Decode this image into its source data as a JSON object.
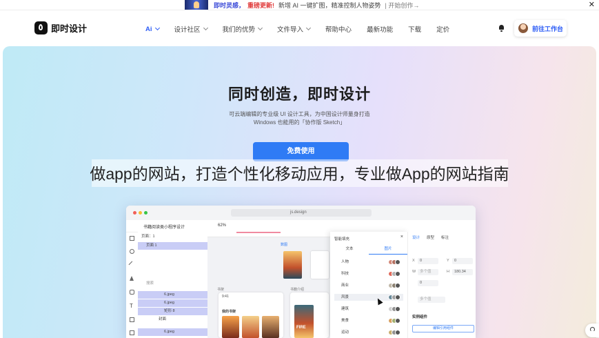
{
  "banner": {
    "highlight_1": "即时灵感，",
    "highlight_2": "重磅更新!",
    "text": "新增 AI 一键扩图，精准控制人物姿势",
    "cta": "| 开始创作→",
    "close_icon": "close-icon"
  },
  "nav": {
    "logo_text": "即时设计",
    "menu": [
      {
        "label": "Ai",
        "has_dropdown": true,
        "active": true
      },
      {
        "label": "设计社区",
        "has_dropdown": true,
        "active": false
      },
      {
        "label": "我们的优势",
        "has_dropdown": true,
        "active": false
      },
      {
        "label": "文件导入",
        "has_dropdown": true,
        "active": false
      },
      {
        "label": "帮助中心",
        "has_dropdown": false,
        "active": false
      },
      {
        "label": "最新功能",
        "has_dropdown": false,
        "active": false
      },
      {
        "label": "下载",
        "has_dropdown": false,
        "active": false
      },
      {
        "label": "定价",
        "has_dropdown": false,
        "active": false
      }
    ],
    "workspace_button": "前往工作台",
    "accent_color": "#2c5cf6"
  },
  "hero": {
    "title": "同时创造，即时设计",
    "subtitle_line1": "可云端编辑的专业级 UI 设计工具，为中国设计师量身打造",
    "subtitle_line2": "Windows 也能用的「协作版 Sketch」",
    "cta_label": "免费使用",
    "cta_color": "#2f7bf5"
  },
  "overlay_caption": "做app的网站，打造个性化移动应用，专业做App的网站指南",
  "mockup": {
    "url": "js.design",
    "file_title": "书籍阅读类小程序设计",
    "zoom": "62%",
    "pages_label": "页面：1",
    "page_item": "页面 1",
    "search_placeholder": "搜索",
    "layers": [
      "6.jpeg",
      "6.jpeg",
      "矩形 8",
      "封面",
      "6.jpeg"
    ],
    "canvas_labels": {
      "frame_a": "书架",
      "frame_b": "书籍介绍",
      "poster_label": "数图",
      "phone_time": "9:41",
      "my_books": "我的书架",
      "poster_text": "FIRE"
    },
    "smart_fill": {
      "title": "智能填充",
      "tabs": [
        "文本",
        "图片"
      ],
      "active_tab": "图片",
      "categories": [
        "人物",
        "科技",
        "商业",
        "风景",
        "建筑",
        "美食",
        "运动"
      ]
    },
    "right_panel": {
      "tabs": [
        "设计",
        "原型",
        "标注"
      ],
      "x": "0",
      "y": "0",
      "w_placeholder": "多个值",
      "h": "180.34",
      "rotation": "0",
      "multi_value": "多个值",
      "instance_heading": "实例组件",
      "instance_button": "编辑引用组件"
    }
  },
  "help_icon": "headset-icon"
}
